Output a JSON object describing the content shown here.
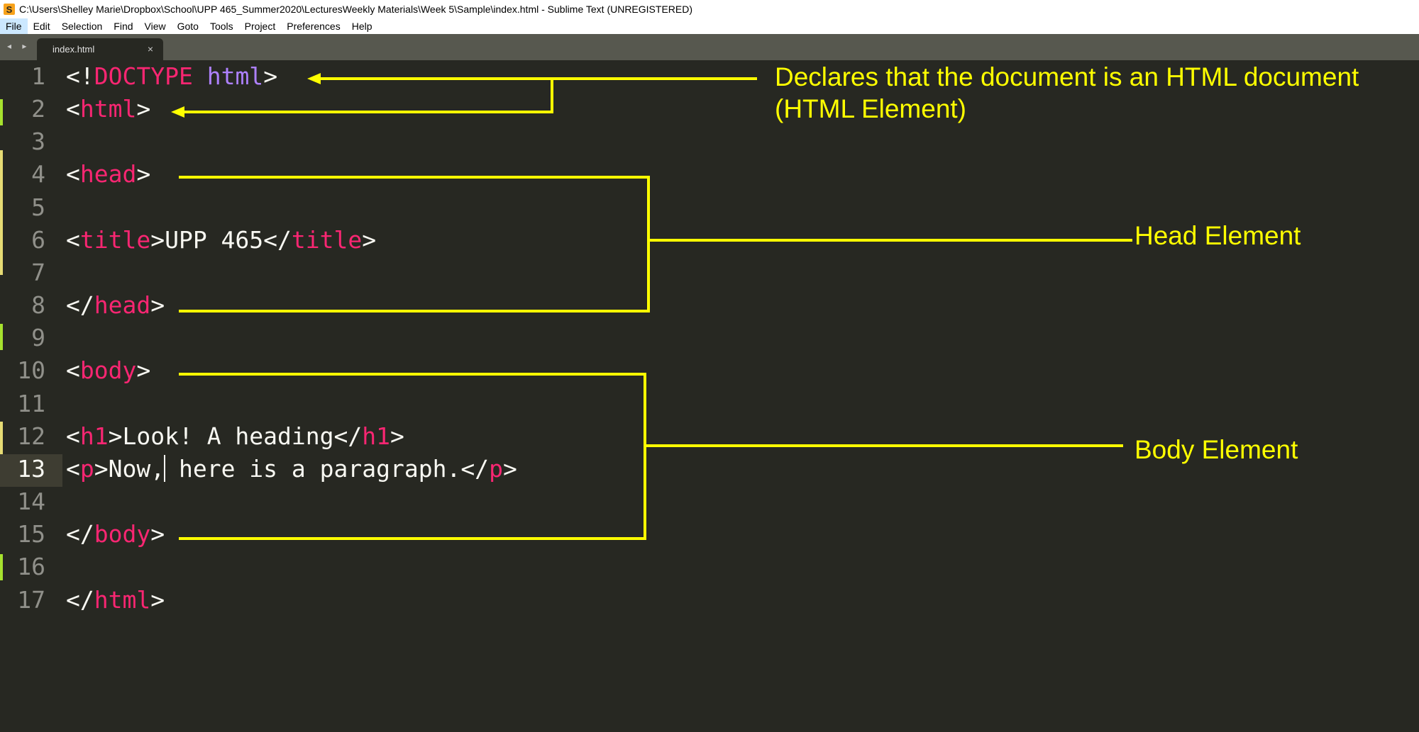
{
  "window": {
    "title": "C:\\Users\\Shelley Marie\\Dropbox\\School\\UPP 465_Summer2020\\LecturesWeekly Materials\\Week 5\\Sample\\index.html - Sublime Text (UNREGISTERED)",
    "app_icon_glyph": "S"
  },
  "menu": [
    "File",
    "Edit",
    "Selection",
    "Find",
    "View",
    "Goto",
    "Tools",
    "Project",
    "Preferences",
    "Help"
  ],
  "tab": {
    "label": "index.html",
    "close_glyph": "×",
    "nav_glyph": "◂ ▸"
  },
  "lines": [
    {
      "n": "1"
    },
    {
      "n": "2"
    },
    {
      "n": "3"
    },
    {
      "n": "4"
    },
    {
      "n": "5"
    },
    {
      "n": "6"
    },
    {
      "n": "7"
    },
    {
      "n": "8"
    },
    {
      "n": "9"
    },
    {
      "n": "10"
    },
    {
      "n": "11"
    },
    {
      "n": "12"
    },
    {
      "n": "13"
    },
    {
      "n": "14"
    },
    {
      "n": "15"
    },
    {
      "n": "16"
    },
    {
      "n": "17"
    }
  ],
  "code": {
    "l1": {
      "open": "<!",
      "kw": "DOCTYPE",
      "attr": "html",
      "close": ">"
    },
    "l2": {
      "open": "<",
      "tag": "html",
      "close": ">"
    },
    "l4": {
      "open": "<",
      "tag": "head",
      "close": ">"
    },
    "l6": {
      "open": "<",
      "tag": "title",
      "mid": ">UPP 465</",
      "tag2": "title",
      "close": ">"
    },
    "l8": {
      "open": "</",
      "tag": "head",
      "close": ">"
    },
    "l10": {
      "open": "<",
      "tag": "body",
      "close": ">"
    },
    "l12": {
      "open": "<",
      "tag": "h1",
      "mid": ">Look! A heading</",
      "tag2": "h1",
      "close": ">"
    },
    "l13": {
      "open": "<",
      "tag": "p",
      "mid_a": ">Now,",
      "mid_b": " here is a paragraph.</",
      "tag2": "p",
      "close": ">"
    },
    "l15": {
      "open": "</",
      "tag": "body",
      "close": ">"
    },
    "l17": {
      "open": "</",
      "tag": "html",
      "close": ">"
    }
  },
  "annotations": {
    "doctype_line1": "Declares that the document is an HTML document",
    "doctype_line2": "(HTML Element)",
    "head": "Head Element",
    "body": "Body Element"
  },
  "colors": {
    "background": "#272822",
    "tag": "#f92672",
    "attribute": "#ae81ff",
    "text": "#f8f8f2",
    "line_number": "#90908a",
    "annotation": "#ffff00"
  }
}
